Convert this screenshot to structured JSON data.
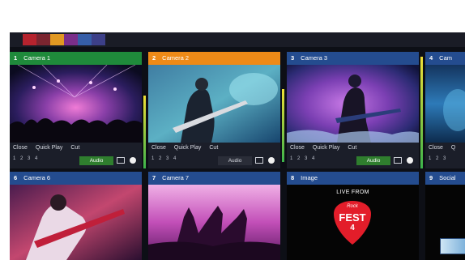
{
  "colors": {
    "swatches": [
      "#b5232e",
      "#7b2530",
      "#e19822",
      "#7a2e8a",
      "#365ea8",
      "#3c3f88"
    ],
    "camera1_header": "#1f8a3b",
    "camera2_header": "#ee8a17",
    "default_header": "#244c8f",
    "audio_active": "#2f7e2e"
  },
  "tiles": [
    {
      "number": "1",
      "label": "Camera 1"
    },
    {
      "number": "2",
      "label": "Camera 2"
    },
    {
      "number": "3",
      "label": "Camera 3"
    },
    {
      "number": "4",
      "label": "Cam"
    },
    {
      "number": "6",
      "label": "Camera 6"
    },
    {
      "number": "7",
      "label": "Camera 7"
    },
    {
      "number": "8",
      "label": "Image"
    },
    {
      "number": "9",
      "label": "Social"
    }
  ],
  "controls": {
    "close": "Close",
    "quick_play": "Quick Play",
    "cut": "Cut",
    "audio": "Audio",
    "layers": [
      "1",
      "2",
      "3",
      "4"
    ],
    "close_partial": "Close",
    "quick_partial": "Q"
  },
  "image_tile": {
    "live_from": "LIVE FROM",
    "logo_top": "Rock",
    "logo_main": "FEST",
    "logo_num": "4"
  }
}
